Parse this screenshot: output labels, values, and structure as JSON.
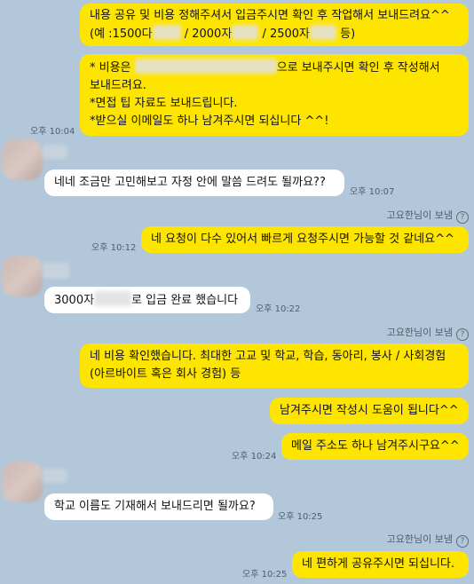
{
  "messages": {
    "m1": {
      "line1": "내용 공유 및 비용 정해주셔서 입금주시면 확인 후 작업해서 보내드려요^^",
      "l2_a": "(예 :1500다",
      "l2_b": "/ 2000자",
      "l2_c": "/ 2500자",
      "l2_d": "등)"
    },
    "m2": {
      "line1_a": "* 비용은",
      "line1_b": "으로 보내주시면 확인 후 작성해서",
      "line2": "보내드려요.",
      "line3": "*면접 팁 자료도 보내드립니다.",
      "line4": "*받으실 이메일도 하나 남겨주시면 되십니다 ^^!",
      "time": "오후 10:04"
    },
    "m3": {
      "text": "네네 조금만 고민해보고 자정 안에 말씀 드려도 될까요??",
      "time": "오후 10:07"
    },
    "via1": "고요한님이 보냄",
    "m4": {
      "text": "네 요청이 다수 있어서 빠르게 요청주시면 가능할 것 같네요^^",
      "time": "오후 10:12"
    },
    "m5": {
      "text_a": "3000자",
      "text_b": "로 입금 완료 했습니다",
      "time": "오후 10:22"
    },
    "via2": "고요한님이 보냄",
    "m6": {
      "line1": "네 비용 확인했습니다. 최대한 고교 및 학교, 학습, 동아리, 봉사 / 사회경험",
      "line2": "(아르바이트 혹은 회사 경험) 등"
    },
    "m7": {
      "text": "남겨주시면 작성시 도움이 됩니다^^"
    },
    "m8": {
      "text": "메일 주소도 하나 남겨주시구요^^",
      "time": "오후 10:24"
    },
    "m9": {
      "text": "학교 이름도 기재해서 보내드리면 될까요?",
      "time": "오후 10:25"
    },
    "via3": "고요한님이 보냄",
    "m10": {
      "text": "네 편하게 공유주시면 되십니다.",
      "time": "오후 10:25"
    },
    "help_icon_glyph": "?"
  },
  "colors": {
    "background": "#b2c7d9",
    "my_bubble": "#fee500",
    "other_bubble": "#ffffff"
  }
}
